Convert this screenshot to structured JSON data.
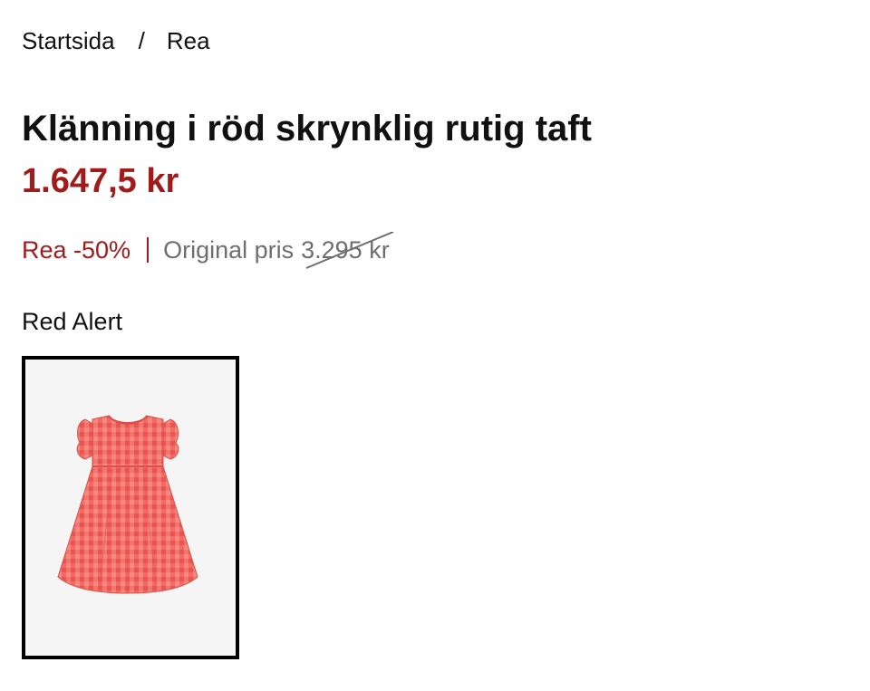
{
  "breadcrumb": {
    "home": "Startsida",
    "separator": "/",
    "current": "Rea"
  },
  "product": {
    "title": "Klänning i röd skrynklig rutig taft",
    "price": "1.647,5 kr",
    "sale_label": "Rea -50%",
    "original_label": "Original pris",
    "original_price": "3.295 kr",
    "brand": "Red Alert",
    "image_icon": "red-gingham-dress-image"
  },
  "colors": {
    "accent_red": "#a01c1c",
    "muted_text": "#6e6e6e",
    "dress_pink": "#f0645e"
  }
}
